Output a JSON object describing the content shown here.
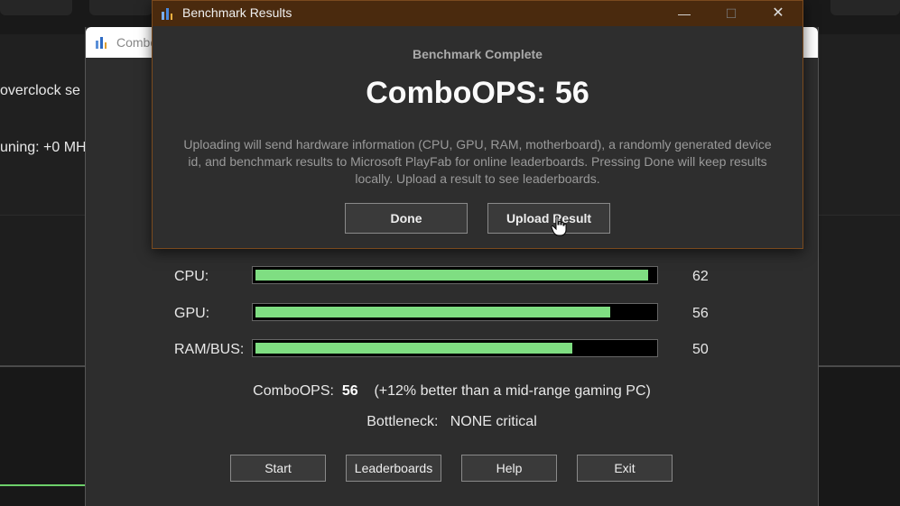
{
  "background": {
    "text_line1": "overclock se",
    "text_line2": "uning: +0 MH"
  },
  "main_window": {
    "title": "Combo",
    "rows": [
      {
        "label": "CPU:",
        "value": "62",
        "fill": 0.985
      },
      {
        "label": "GPU:",
        "value": "56",
        "fill": 0.89
      },
      {
        "label": "RAM/BUS:",
        "value": "50",
        "fill": 0.795
      }
    ],
    "summary": {
      "ops_label": "ComboOPS:",
      "ops_value": "56",
      "ops_note": "(+12% better than a mid-range gaming PC)",
      "bottleneck_label": "Bottleneck:",
      "bottleneck_value": "NONE critical"
    },
    "buttons": {
      "start": "Start",
      "leaderboards": "Leaderboards",
      "help": "Help",
      "exit": "Exit"
    }
  },
  "dialog": {
    "title": "Benchmark Results",
    "subtitle": "Benchmark Complete",
    "score": "ComboOPS: 56",
    "description": "Uploading will send hardware information (CPU, GPU, RAM, motherboard), a randomly generated device id, and benchmark results to Microsoft PlayFab for online leaderboards. Pressing Done will keep results locally. Upload a result to see leaderboards.",
    "done_label": "Done",
    "upload_label": "Upload Result",
    "minimize_glyph": "—",
    "maximize_glyph": "☐",
    "close_glyph": "✕"
  },
  "colors": {
    "bar_fill": "#7fde82",
    "dialog_title_bg": "#4a2a0e"
  },
  "icons": {
    "app": "benchmark-app-icon",
    "cursor": "hand-pointer-icon"
  }
}
